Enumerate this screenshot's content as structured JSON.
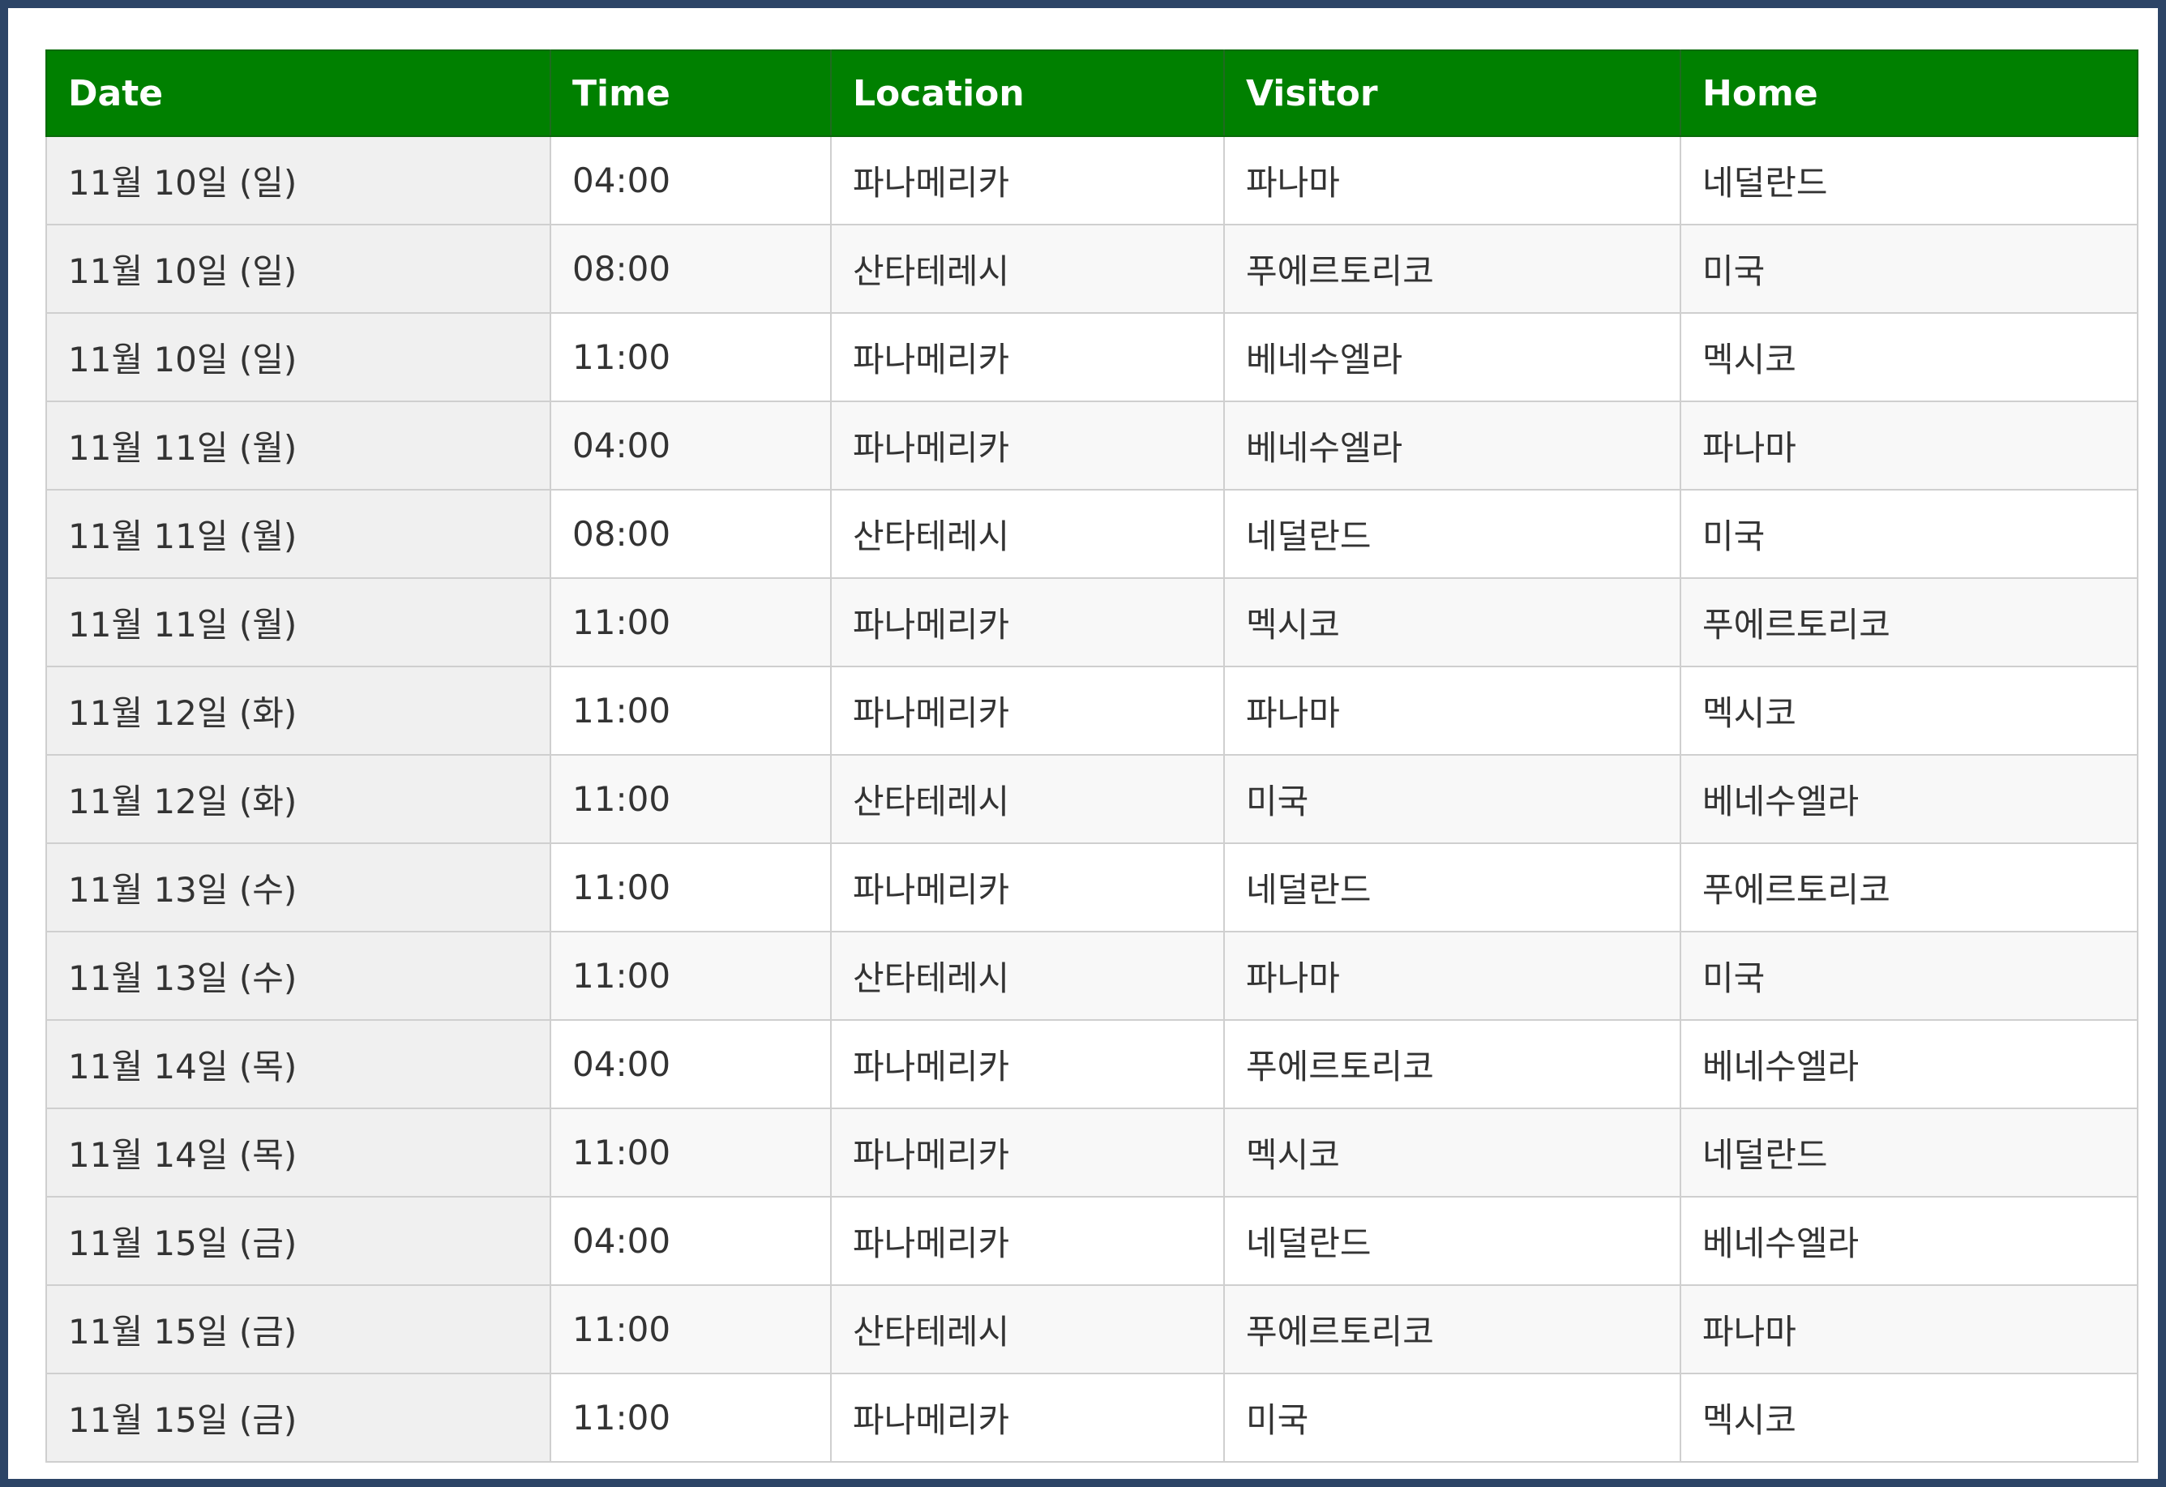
{
  "table": {
    "headers": {
      "date": "Date",
      "time": "Time",
      "location": "Location",
      "visitor": "Visitor",
      "home": "Home"
    },
    "rows": [
      {
        "date": "11월 10일 (일)",
        "time": "04:00",
        "location": "파나메리카",
        "visitor": "파나마",
        "home": "네덜란드"
      },
      {
        "date": "11월 10일 (일)",
        "time": "08:00",
        "location": "산타테레시",
        "visitor": "푸에르토리코",
        "home": "미국"
      },
      {
        "date": "11월 10일 (일)",
        "time": "11:00",
        "location": "파나메리카",
        "visitor": "베네수엘라",
        "home": "멕시코"
      },
      {
        "date": "11월 11일 (월)",
        "time": "04:00",
        "location": "파나메리카",
        "visitor": "베네수엘라",
        "home": "파나마"
      },
      {
        "date": "11월 11일 (월)",
        "time": "08:00",
        "location": "산타테레시",
        "visitor": "네덜란드",
        "home": "미국"
      },
      {
        "date": "11월 11일 (월)",
        "time": "11:00",
        "location": "파나메리카",
        "visitor": "멕시코",
        "home": "푸에르토리코"
      },
      {
        "date": "11월 12일 (화)",
        "time": "11:00",
        "location": "파나메리카",
        "visitor": "파나마",
        "home": "멕시코"
      },
      {
        "date": "11월 12일 (화)",
        "time": "11:00",
        "location": "산타테레시",
        "visitor": "미국",
        "home": "베네수엘라"
      },
      {
        "date": "11월 13일 (수)",
        "time": "11:00",
        "location": "파나메리카",
        "visitor": "네덜란드",
        "home": "푸에르토리코"
      },
      {
        "date": "11월 13일 (수)",
        "time": "11:00",
        "location": "산타테레시",
        "visitor": "파나마",
        "home": "미국"
      },
      {
        "date": "11월 14일 (목)",
        "time": "04:00",
        "location": "파나메리카",
        "visitor": "푸에르토리코",
        "home": "베네수엘라"
      },
      {
        "date": "11월 14일 (목)",
        "time": "11:00",
        "location": "파나메리카",
        "visitor": "멕시코",
        "home": "네덜란드"
      },
      {
        "date": "11월 15일 (금)",
        "time": "04:00",
        "location": "파나메리카",
        "visitor": "네덜란드",
        "home": "베네수엘라"
      },
      {
        "date": "11월 15일 (금)",
        "time": "11:00",
        "location": "산타테레시",
        "visitor": "푸에르토리코",
        "home": "파나마"
      },
      {
        "date": "11월 15일 (금)",
        "time": "11:00",
        "location": "파나메리카",
        "visitor": "미국",
        "home": "멕시코"
      }
    ]
  },
  "colors": {
    "header_bg": "#008000",
    "frame_border": "#2c4466",
    "date_cell_bg": "#f0f0f0"
  }
}
